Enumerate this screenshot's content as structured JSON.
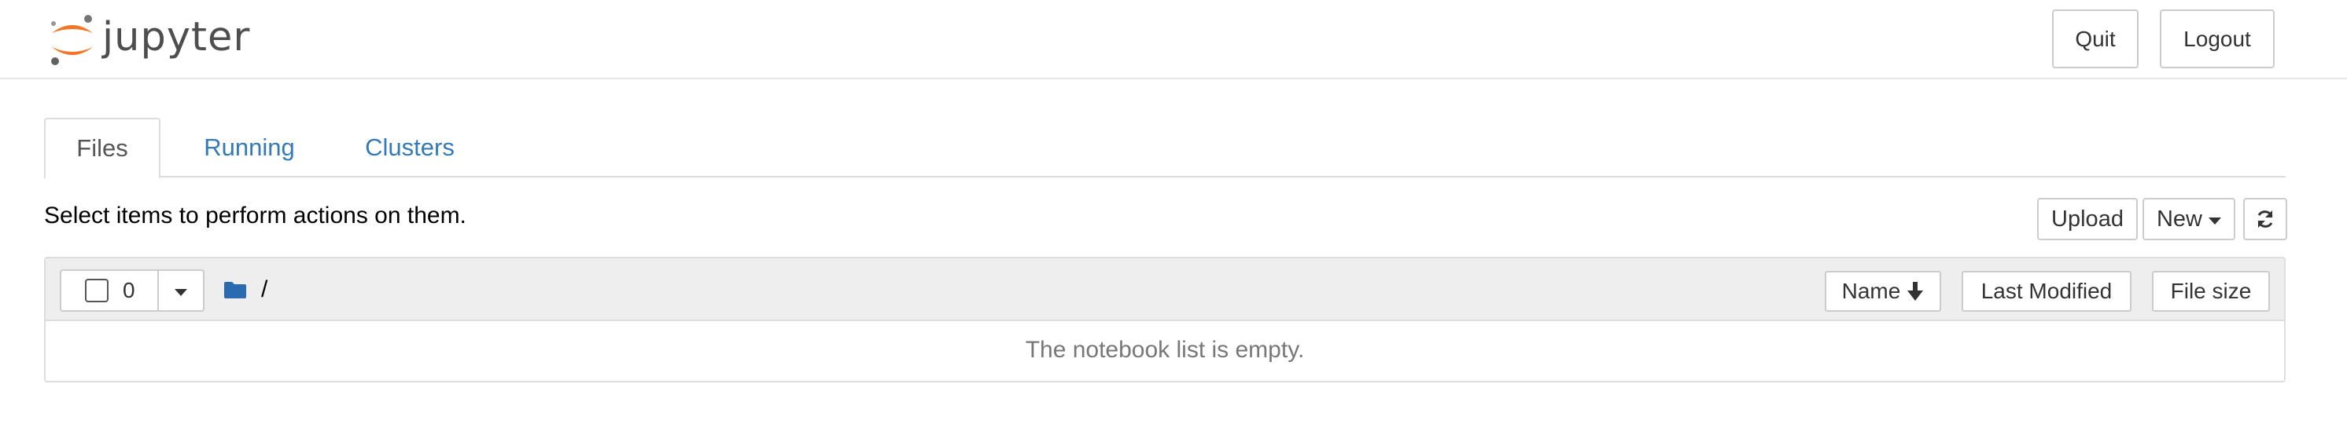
{
  "header": {
    "logo_text": "jupyter",
    "quit_label": "Quit",
    "logout_label": "Logout"
  },
  "tabs": [
    {
      "label": "Files",
      "active": true
    },
    {
      "label": "Running",
      "active": false
    },
    {
      "label": "Clusters",
      "active": false
    }
  ],
  "toolbar": {
    "info_text": "Select items to perform actions on them.",
    "upload_label": "Upload",
    "new_label": "New",
    "refresh_icon": "refresh-icon"
  },
  "file_list": {
    "selected_count": "0",
    "breadcrumb_root": "/",
    "folder_icon": "folder-icon",
    "sort_name_label": "Name",
    "sort_modified_label": "Last Modified",
    "sort_size_label": "File size",
    "empty_message": "The notebook list is empty."
  },
  "colors": {
    "link": "#337ab7",
    "logo_orange": "#f37626",
    "folder": "#2a6ab0",
    "header_bg": "#eeeeee"
  }
}
